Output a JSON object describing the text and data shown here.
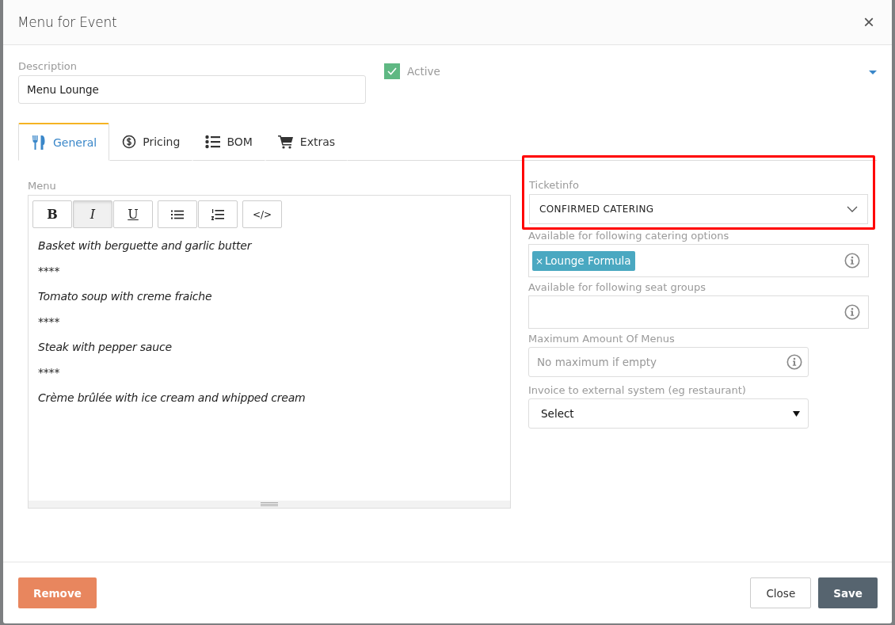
{
  "dialog": {
    "title": "Menu for Event",
    "close": "×"
  },
  "description": {
    "label": "Description",
    "value": "Menu Lounge"
  },
  "active": {
    "label": "Active",
    "checked": true
  },
  "tabs": [
    {
      "label": "General",
      "kind": "utensils",
      "selected": true
    },
    {
      "label": "Pricing",
      "kind": "dollar",
      "selected": false
    },
    {
      "label": "BOM",
      "kind": "list",
      "selected": false
    },
    {
      "label": "Extras",
      "kind": "cart",
      "selected": false
    }
  ],
  "editor": {
    "label": "Menu",
    "toolbar": [
      {
        "kind": "bold",
        "label": "B",
        "active": false
      },
      {
        "kind": "italic",
        "label": "I",
        "active": true
      },
      {
        "kind": "underline",
        "label": "U",
        "active": false
      },
      {
        "kind": "bullets",
        "active": false
      },
      {
        "kind": "numbers",
        "active": false
      },
      {
        "kind": "code",
        "label": "</>",
        "active": false
      }
    ],
    "lines": [
      "Basket with berguette and garlic butter",
      "****",
      "Tomato soup with creme fraiche",
      "****",
      "Steak with pepper sauce",
      "****",
      "Crème brûlée with ice cream and whipped cream"
    ]
  },
  "ticketinfo": {
    "label": "Ticketinfo",
    "value": "CONFIRMED CATERING",
    "highlighted": true
  },
  "catering_options": {
    "label": "Available for following catering options",
    "tags": [
      {
        "label": "Lounge Formula",
        "remove": "×"
      }
    ]
  },
  "seat_groups": {
    "label": "Available for following seat groups"
  },
  "max_menus": {
    "label": "Maximum Amount Of Menus",
    "placeholder": "No maximum if empty"
  },
  "invoice": {
    "label": "Invoice to external system (eg restaurant)",
    "value": "Select"
  },
  "footer": {
    "remove": "Remove",
    "close": "Close",
    "save": "Save"
  }
}
